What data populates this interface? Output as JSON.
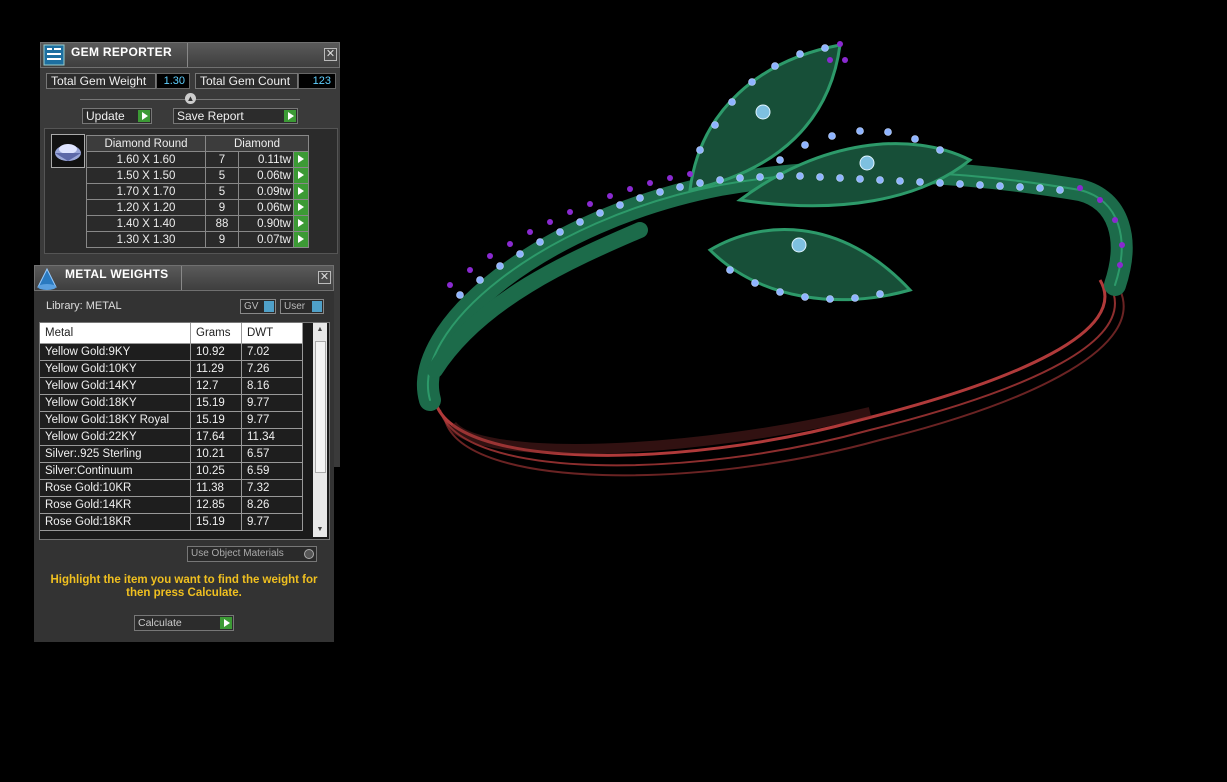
{
  "gem_reporter": {
    "title": "GEM REPORTER",
    "close_icon": "✕",
    "total_weight_label": "Total Gem Weight",
    "total_weight_value": "1.30",
    "total_count_label": "Total Gem Count",
    "total_count_value": "123",
    "update_label": "Update",
    "save_report_label": "Save Report",
    "col_shape": "Diamond Round",
    "col_material": "Diamond",
    "rows": [
      {
        "size": "1.60 X 1.60",
        "count": "7",
        "weight": "0.11tw"
      },
      {
        "size": "1.50 X 1.50",
        "count": "5",
        "weight": "0.06tw"
      },
      {
        "size": "1.70 X 1.70",
        "count": "5",
        "weight": "0.09tw"
      },
      {
        "size": "1.20 X 1.20",
        "count": "9",
        "weight": "0.06tw"
      },
      {
        "size": "1.40 X 1.40",
        "count": "88",
        "weight": "0.90tw"
      },
      {
        "size": "1.30 X 1.30",
        "count": "9",
        "weight": "0.07tw"
      }
    ]
  },
  "metal_weights": {
    "title": "METAL WEIGHTS",
    "close_icon": "✕",
    "library_label": "Library: METAL",
    "gv_label": "GV",
    "user_label": "User",
    "columns": {
      "metal": "Metal",
      "grams": "Grams",
      "dwt": "DWT"
    },
    "rows": [
      {
        "metal": "Yellow Gold:9KY",
        "grams": "10.92",
        "dwt": "7.02"
      },
      {
        "metal": "Yellow Gold:10KY",
        "grams": "11.29",
        "dwt": "7.26"
      },
      {
        "metal": "Yellow Gold:14KY",
        "grams": "12.7",
        "dwt": "8.16"
      },
      {
        "metal": "Yellow Gold:18KY",
        "grams": "15.19",
        "dwt": "9.77"
      },
      {
        "metal": "Yellow Gold:18KY Royal",
        "grams": "15.19",
        "dwt": "9.77"
      },
      {
        "metal": "Yellow Gold:22KY",
        "grams": "17.64",
        "dwt": "11.34"
      },
      {
        "metal": "Silver:.925 Sterling",
        "grams": "10.21",
        "dwt": "6.57"
      },
      {
        "metal": "Silver:Continuum",
        "grams": "10.25",
        "dwt": "6.59"
      },
      {
        "metal": "Rose Gold:10KR",
        "grams": "11.38",
        "dwt": "7.32"
      },
      {
        "metal": "Rose Gold:14KR",
        "grams": "12.85",
        "dwt": "8.26"
      },
      {
        "metal": "Rose Gold:18KR",
        "grams": "15.19",
        "dwt": "9.77"
      }
    ],
    "use_object_materials_label": "Use Object Materials",
    "hint": "Highlight the item you want to find the weight for then press Calculate.",
    "calculate_label": "Calculate"
  },
  "icons": {
    "gem_panel_icon": "document-grid-icon",
    "metal_panel_icon": "cone-icon",
    "gem_shape_icon": "round-gem-icon",
    "row_action_icon": "play-arrow-icon"
  },
  "colors": {
    "panel_bg": "#3a3a3a",
    "accent_green": "#3c9a35",
    "value_blue": "#5fd0ff",
    "hint_yellow": "#f0c020",
    "model_green": "#1c6b4a",
    "model_gem_blue": "#8fb4ff",
    "model_prong_purple": "#8a2ad0",
    "model_shank_red": "#c04040"
  }
}
